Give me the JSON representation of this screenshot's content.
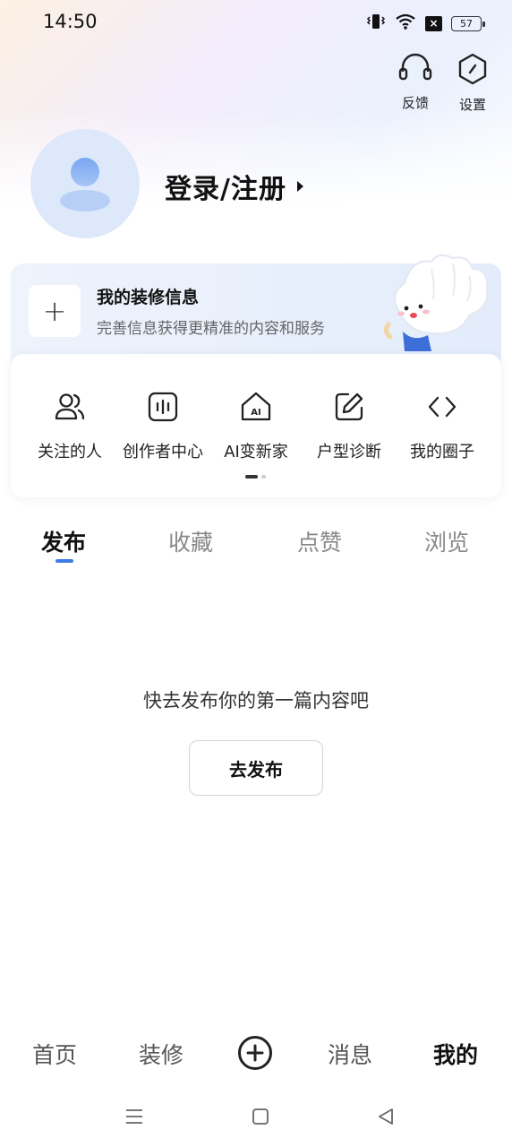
{
  "status_bar": {
    "time": "14:50",
    "battery": "57"
  },
  "top_actions": {
    "feedback_label": "反馈",
    "settings_label": "设置"
  },
  "profile": {
    "login_label": "登录/注册"
  },
  "decor_card": {
    "title": "我的装修信息",
    "subtitle": "完善信息获得更精准的内容和服务",
    "plus": "+"
  },
  "quick_menu": {
    "items": [
      {
        "label": "关注的人",
        "icon": "people-icon"
      },
      {
        "label": "创作者中心",
        "icon": "creator-icon"
      },
      {
        "label": "AI变新家",
        "icon": "ai-home-icon"
      },
      {
        "label": "户型诊断",
        "icon": "edit-icon"
      },
      {
        "label": "我的圈子",
        "icon": "code-icon"
      }
    ]
  },
  "tabs": [
    {
      "label": "发布",
      "active": true
    },
    {
      "label": "收藏",
      "active": false
    },
    {
      "label": "点赞",
      "active": false
    },
    {
      "label": "浏览",
      "active": false
    }
  ],
  "empty_state": {
    "message": "快去发布你的第一篇内容吧",
    "button": "去发布"
  },
  "bottom_nav": {
    "items": [
      {
        "label": "首页",
        "active": false
      },
      {
        "label": "装修",
        "active": false
      },
      {
        "label": "消息",
        "active": false
      },
      {
        "label": "我的",
        "active": true
      }
    ]
  },
  "colors": {
    "accent": "#3c7be6",
    "card_bg": "#e3ecfb"
  }
}
